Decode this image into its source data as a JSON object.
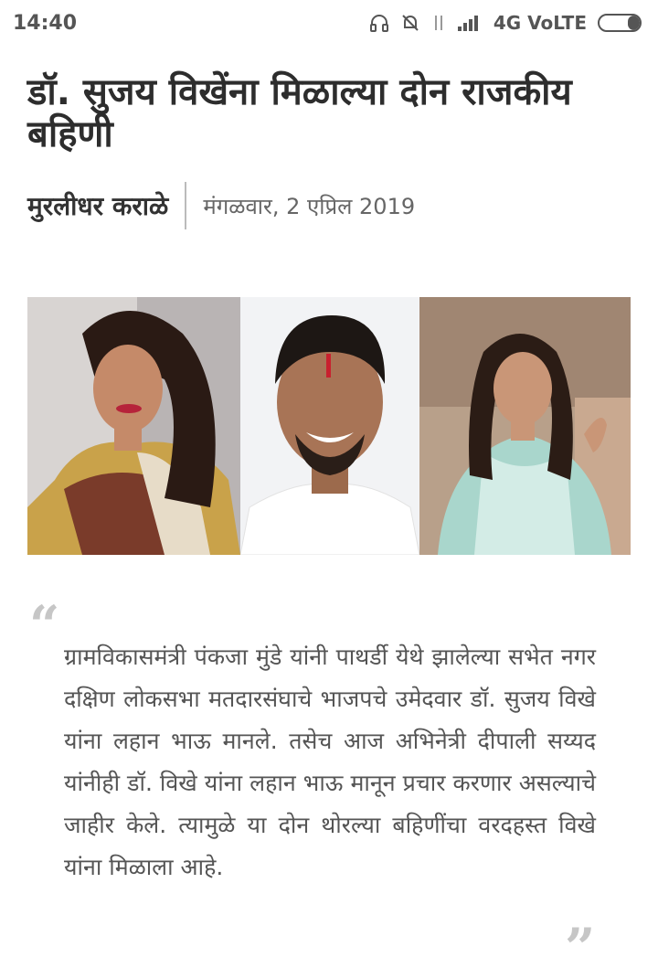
{
  "status_bar": {
    "time": "14:40",
    "network": "4G VoLTE",
    "battery_level": 0.3,
    "icons": [
      "headset-icon",
      "bell-off-icon",
      "data-arrows-icon",
      "signal-icon",
      "battery-icon"
    ]
  },
  "article": {
    "title": "डॉ. सुजय विखेंना मिळाल्या दोन राजकीय बहिणी",
    "author": "मुरलीधर कराळे",
    "date": "मंगळवार, 2 एप्रिल 2019",
    "quote_open": "“",
    "quote_close": "”",
    "quote_text": "ग्रामविकासमंत्री पंकजा मुंडे यांनी पाथर्डी येथे झालेल्या सभेत नगर दक्षिण लोकसभा मतदारसंघाचे भाजपचे उमेदवार डॉ. सुजय विखे यांना लहान भाऊ मानले. तसेच आज अभिनेत्री दीपाली सय्यद यांनीही डॉ. विखे यांना लहान भाऊ मानून प्रचार करणार असल्याचे जाहीर केले. त्यामुळे या दोन थोरल्या बहिणींचा वरदहस्त विखे यांना मिळाला आहे."
  },
  "colors": {
    "title": "#2d2d2d",
    "quote_marks": "#c6c6c6",
    "body_text": "#555555"
  }
}
